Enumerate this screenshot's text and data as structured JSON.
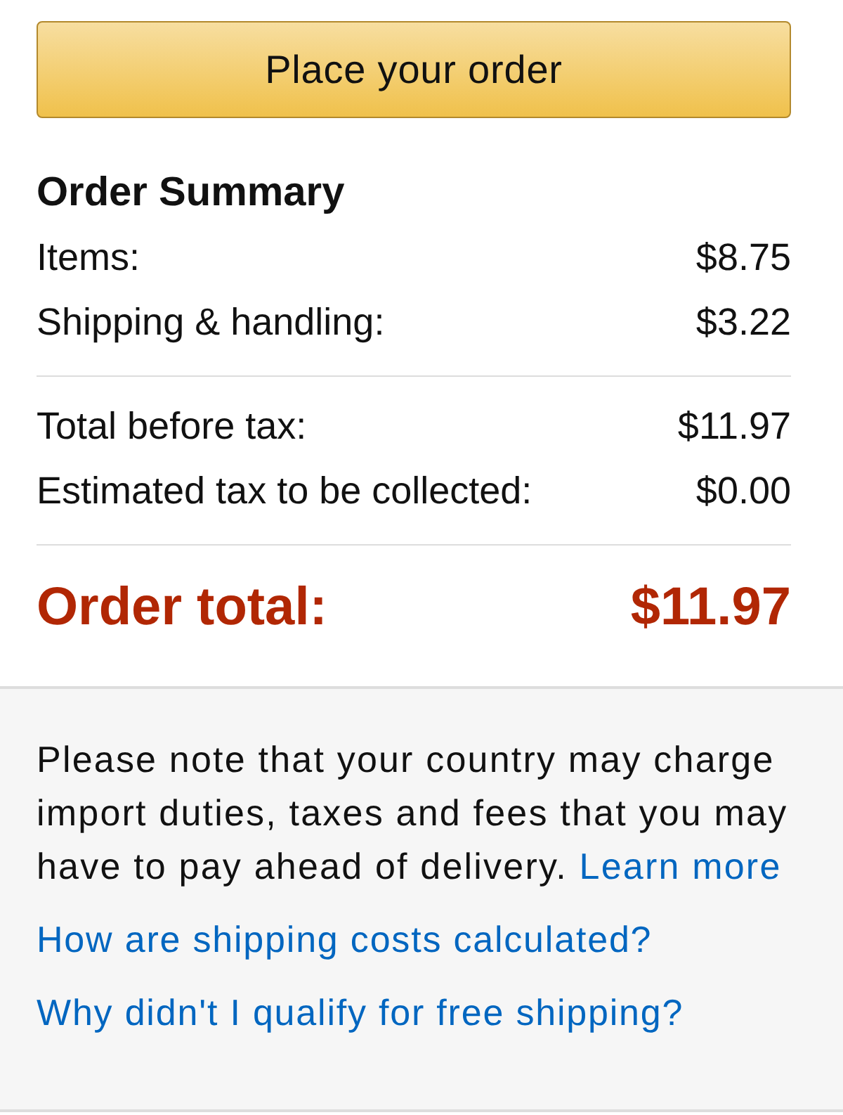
{
  "place_order_button": {
    "label": "Place your order"
  },
  "order_summary": {
    "title": "Order Summary",
    "line_groups": [
      [
        {
          "label": "Items:",
          "amount": "$8.75"
        },
        {
          "label": "Shipping & handling:",
          "amount": "$3.22"
        }
      ],
      [
        {
          "label": "Total before tax:",
          "amount": "$11.97"
        },
        {
          "label": "Estimated tax to be collected:",
          "amount": "$0.00"
        }
      ]
    ],
    "order_total": {
      "label": "Order total:",
      "amount": "$11.97"
    }
  },
  "notice": {
    "text": "Please note that your country may charge import duties, taxes and fees that you may have to pay ahead of delivery.",
    "link": "Learn more"
  },
  "help_links": [
    "How are shipping costs calculated?",
    "Why didn't I qualify for free shipping?"
  ]
}
